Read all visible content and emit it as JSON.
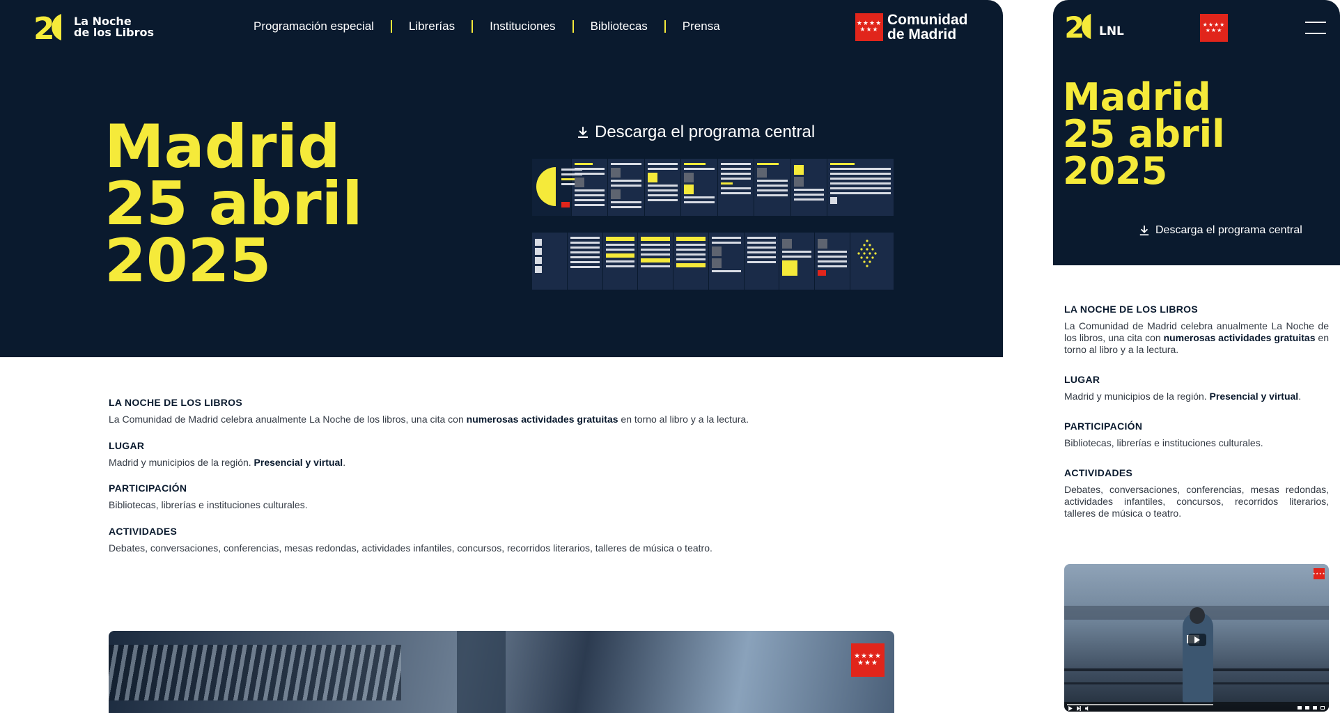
{
  "desktop": {
    "logo": {
      "mark": "2(",
      "text_line1": "La Noche",
      "text_line2": "de los Libros"
    },
    "nav": [
      {
        "label": "Programación especial"
      },
      {
        "label": "Librerías"
      },
      {
        "label": "Instituciones"
      },
      {
        "label": "Bibliotecas"
      },
      {
        "label": "Prensa"
      }
    ],
    "cm_logo": {
      "line1": "Comunidad",
      "line2": "de Madrid"
    },
    "hero": {
      "line1": "Madrid",
      "line2": "25 abril",
      "line3": "2025"
    },
    "download_label": "Descarga el programa central",
    "info": [
      {
        "title": "LA NOCHE DE LOS LIBROS",
        "text_a": "La Comunidad de Madrid celebra anualmente La Noche de los libros, una cita con ",
        "text_b": "numerosas actividades gratuitas",
        "text_c": " en torno al libro y a la lectura."
      },
      {
        "title": "LUGAR",
        "text_a": "Madrid y municipios de la región. ",
        "text_b": "Presencial y virtual",
        "text_c": "."
      },
      {
        "title": "PARTICIPACIÓN",
        "text_a": "Bibliotecas, librerías e instituciones culturales.",
        "text_b": "",
        "text_c": ""
      },
      {
        "title": "ACTIVIDADES",
        "text_a": "Debates, conversaciones, conferencias, mesas redondas, actividades infantiles, concursos, recorridos literarios, talleres de música o teatro.",
        "text_b": "",
        "text_c": ""
      }
    ]
  },
  "mobile": {
    "logo": {
      "mark": "2(",
      "text": "LNL"
    },
    "hero": {
      "line1": "Madrid",
      "line2": "25 abril",
      "line3": "2025"
    },
    "download_label": "Descarga el programa central",
    "info": [
      {
        "title": "LA NOCHE DE LOS LIBROS",
        "text_a": "La Comunidad de Madrid celebra anualmente La Noche de los libros, una cita con ",
        "text_b": "numerosas actividades gratuitas",
        "text_c": " en torno al libro y a la lectura."
      },
      {
        "title": "LUGAR",
        "text_a": "Madrid y municipios de la región. ",
        "text_b": "Presencial y virtual",
        "text_c": "."
      },
      {
        "title": "PARTICIPACIÓN",
        "text_a": "Bibliotecas, librerías e instituciones culturales.",
        "text_b": "",
        "text_c": ""
      },
      {
        "title": "ACTIVIDADES",
        "text_a": "Debates, conversaciones, conferencias, mesas redondas, actividades infantiles, concursos, recorridos literarios, talleres de música o teatro.",
        "text_b": "",
        "text_c": ""
      }
    ]
  },
  "colors": {
    "navy": "#0a1a2e",
    "yellow": "#f5ea3a",
    "red": "#e1251b"
  },
  "icons": {
    "download": "download-icon",
    "menu": "hamburger-menu-icon",
    "play": "play-icon"
  }
}
